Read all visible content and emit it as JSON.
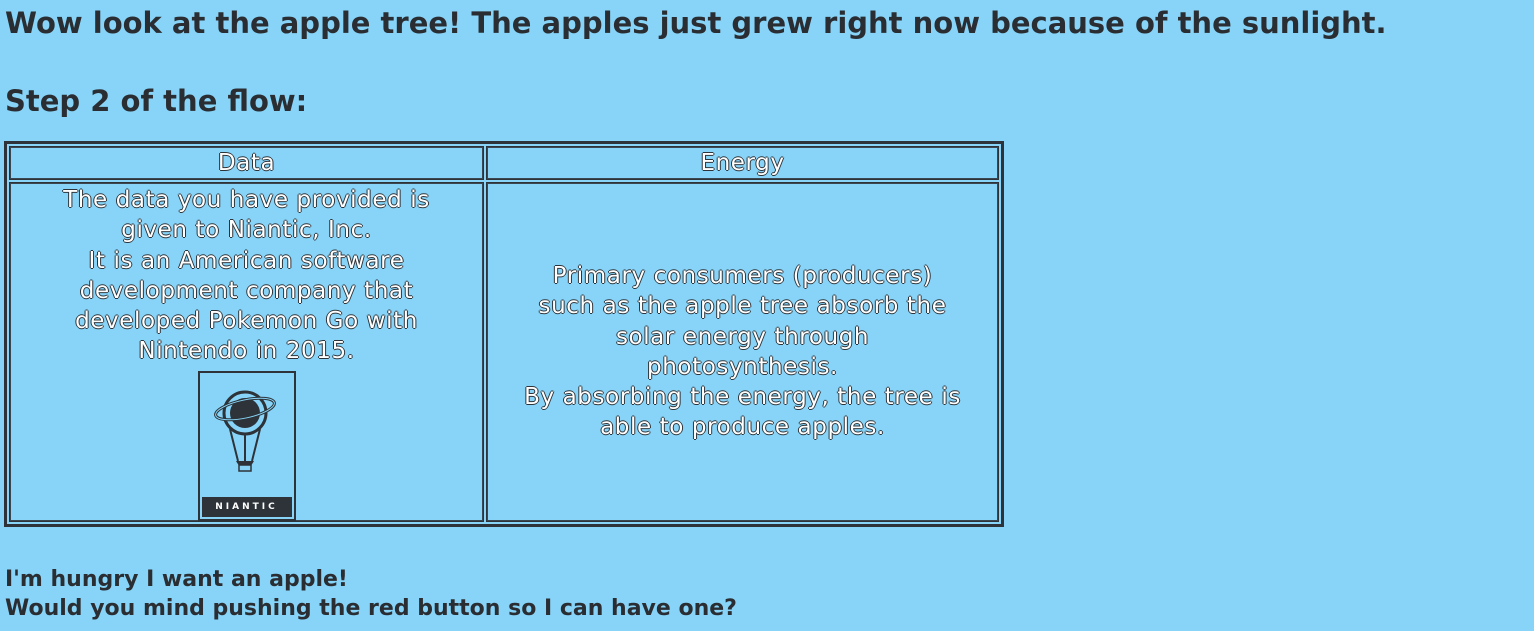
{
  "header": {
    "title": "Wow look at the apple tree! The apples just grew right now because of the sunlight.",
    "step": "Step 2 of the flow:"
  },
  "table": {
    "columns": [
      "Data",
      "Energy"
    ],
    "data_cell": "The data you have provided is\ngiven to Niantic, Inc.\nIt is an American software\ndevelopment company that\ndeveloped Pokemon Go with\nNintendo in 2015.",
    "energy_cell": "Primary consumers (producers)\nsuch as the apple tree absorb the\nsolar energy through\nphotosynthesis.\nBy absorbing the energy, the tree is\nable to produce apples.",
    "logo": {
      "icon": "niantic-logo-icon",
      "wordmark": "NIANTIC"
    }
  },
  "footer": {
    "line1": "I'm hungry I want an apple!",
    "line2": "Would you mind pushing the red button so I can have one?"
  },
  "colors": {
    "background": "#87d4f8",
    "text": "#2a2e33",
    "cell_text": "#ffffff"
  }
}
